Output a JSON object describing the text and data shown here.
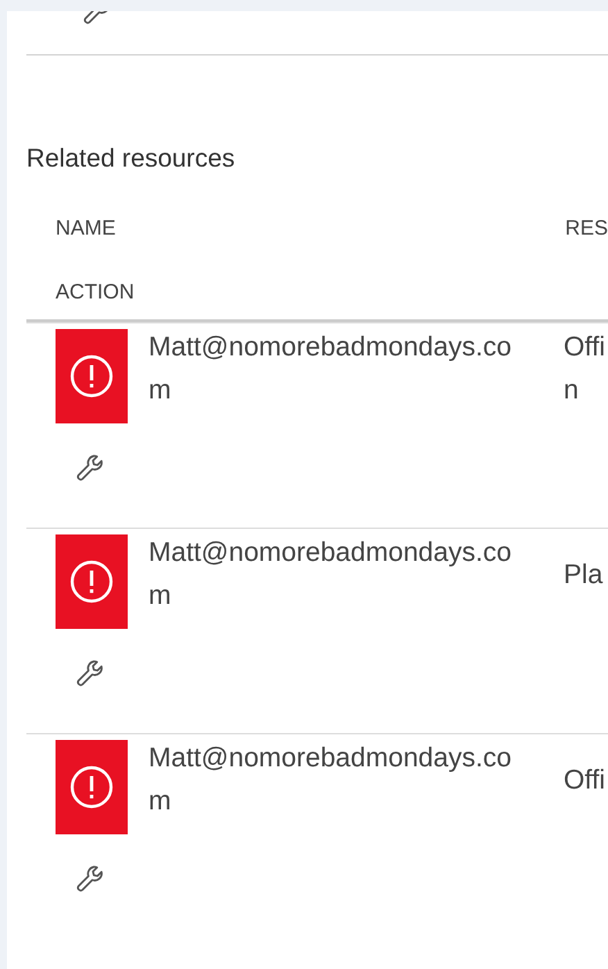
{
  "section_title": "Related resources",
  "columns": [
    {
      "label": "NAME"
    },
    {
      "label": "RES"
    },
    {
      "label": "ACTION"
    }
  ],
  "rows": [
    {
      "name": "Matt@nomorebadmondays.com",
      "resource_type": [
        "Offi",
        "n"
      ]
    },
    {
      "name": "Matt@nomorebadmondays.com",
      "resource_type": [
        "Pla"
      ]
    },
    {
      "name": "Matt@nomorebadmondays.com",
      "resource_type": [
        "Offi"
      ]
    }
  ]
}
